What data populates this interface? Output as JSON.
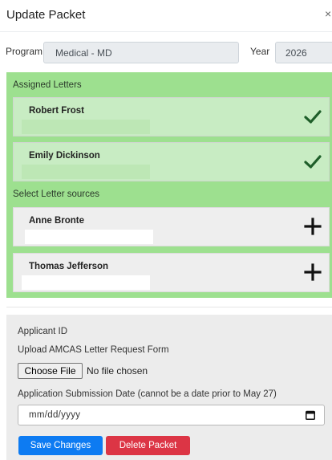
{
  "modal": {
    "title": "Update Packet",
    "close_glyph": "×"
  },
  "form": {
    "program_label": "Program",
    "program_value": "Medical - MD",
    "year_label": "Year",
    "year_value": "2026"
  },
  "assigned": {
    "label": "Assigned Letters",
    "items": [
      {
        "name": "Robert Frost",
        "icon": "check-icon"
      },
      {
        "name": "Emily Dickinson",
        "icon": "check-icon"
      }
    ]
  },
  "sources": {
    "label": "Select Letter sources",
    "items": [
      {
        "name": "Anne Bronte",
        "icon": "plus-icon"
      },
      {
        "name": "Thomas Jefferson",
        "icon": "plus-icon"
      }
    ]
  },
  "details": {
    "applicant_id_label": "Applicant ID",
    "upload_label": "Upload AMCAS Letter Request Form",
    "choose_file": "Choose File",
    "file_status": "No file chosen",
    "date_label": "Application Submission Date (cannot be a date prior to May 27)",
    "date_placeholder": "mm/dd/yyyy"
  },
  "actions": {
    "save": "Save Changes",
    "delete": "Delete Packet"
  },
  "colors": {
    "assigned_panel": "#9de08f",
    "check": "#1e5e29",
    "save": "#0d7bf2",
    "delete": "#dc3545"
  }
}
